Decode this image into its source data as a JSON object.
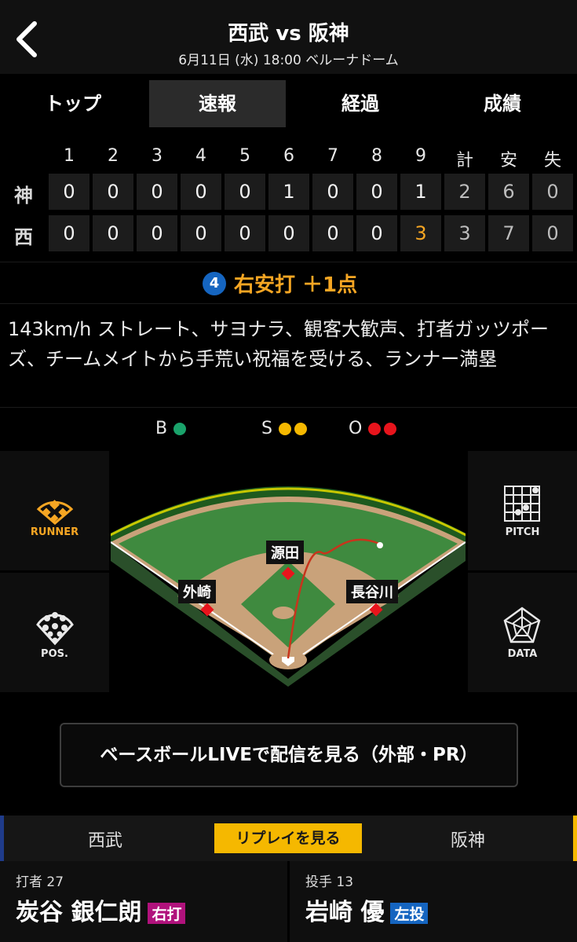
{
  "header": {
    "title": "西武 vs 阪神",
    "subtitle": "6月11日 (水) 18:00 ベルーナドーム"
  },
  "tabs": [
    {
      "label": "トップ",
      "active": false
    },
    {
      "label": "速報",
      "active": true
    },
    {
      "label": "経過",
      "active": false
    },
    {
      "label": "成績",
      "active": false
    }
  ],
  "scoreboard": {
    "columns": [
      "1",
      "2",
      "3",
      "4",
      "5",
      "6",
      "7",
      "8",
      "9",
      "計",
      "安",
      "失"
    ],
    "rows": [
      {
        "team": "神",
        "innings": [
          "0",
          "0",
          "0",
          "0",
          "0",
          "1",
          "0",
          "0",
          "1"
        ],
        "totals": [
          "2",
          "6",
          "0"
        ]
      },
      {
        "team": "西",
        "innings": [
          "0",
          "0",
          "0",
          "0",
          "0",
          "0",
          "0",
          "0",
          "3"
        ],
        "totals": [
          "3",
          "7",
          "0"
        ]
      }
    ]
  },
  "play": {
    "number": "4",
    "result": "右安打 ＋1点"
  },
  "description": "143km/h ストレート、サヨナラ、観客大歓声、打者ガッツポーズ、チームメイトから手荒い祝福を受ける、ランナー満塁",
  "count": {
    "b_label": "B",
    "s_label": "S",
    "o_label": "O",
    "balls": 1,
    "strikes": 2,
    "outs": 2,
    "colors": {
      "ball": "#1aa36b",
      "strike": "#f5b800",
      "out": "#e8141c"
    }
  },
  "side_buttons": {
    "runner": "RUNNER",
    "pos": "POS.",
    "pitch": "PITCH",
    "data": "DATA"
  },
  "field": {
    "runners": {
      "second": "源田",
      "third": "外崎",
      "first": "長谷川"
    }
  },
  "stream_button": "ベースボールLIVEで配信を見る（外部・PR）",
  "teams_bar": {
    "left": "西武",
    "replay": "リプレイを見る",
    "right": "阪神"
  },
  "batter": {
    "role": "打者 27",
    "name": "炭谷 銀仁朗",
    "badge": "右打",
    "badge_color": "#b0127c"
  },
  "pitcher": {
    "role": "投手 13",
    "name": "岩崎 優",
    "badge": "左投",
    "badge_color": "#1565c0"
  }
}
